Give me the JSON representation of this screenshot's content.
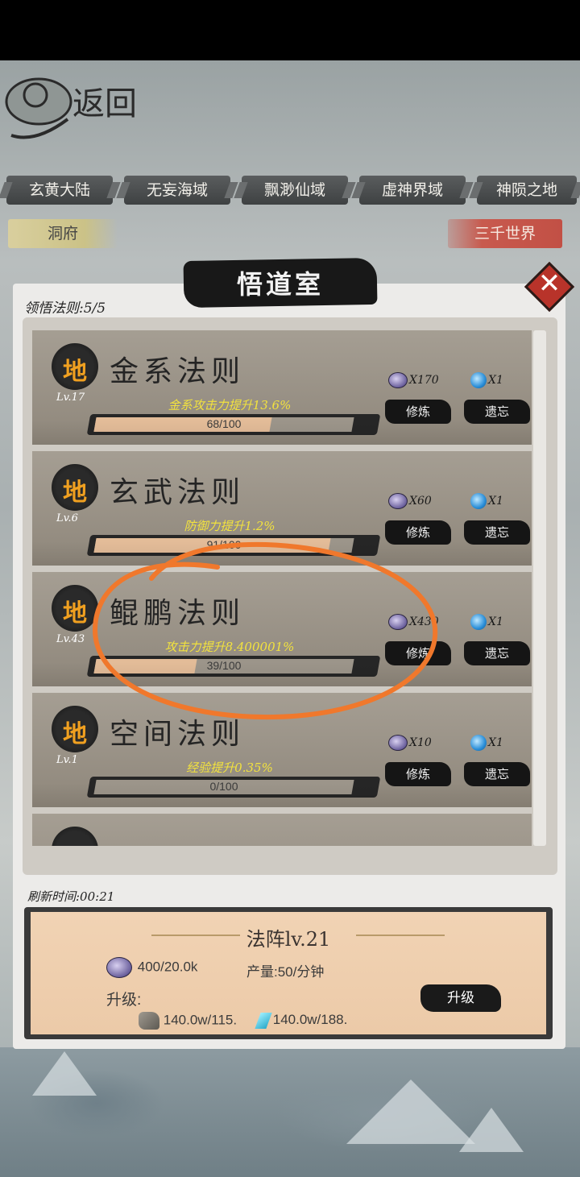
{
  "header": {
    "logo_text": "返回"
  },
  "region_tabs": [
    "玄黄大陆",
    "无妄海域",
    "飘渺仙域",
    "虚神界域",
    "神陨之地"
  ],
  "sub_tabs": {
    "left": "洞府",
    "right": "三千世界"
  },
  "panel": {
    "title": "悟道室",
    "close_label": "✕",
    "count_label": "领悟法则:5/5",
    "refresh_label": "刷新时间:00:21"
  },
  "laws": [
    {
      "badge": "地",
      "level": "Lv.17",
      "name": "金系法则",
      "effect": "金系攻击力提升13.6%",
      "progress_text": "68/100",
      "progress": 0.68,
      "stone_cost": "X170",
      "orb_cost": "X1",
      "train_label": "修炼",
      "forget_label": "遗忘"
    },
    {
      "badge": "地",
      "level": "Lv.6",
      "name": "玄武法则",
      "effect": "防御力提升1.2%",
      "progress_text": "91/100",
      "progress": 0.91,
      "stone_cost": "X60",
      "orb_cost": "X1",
      "train_label": "修炼",
      "forget_label": "遗忘"
    },
    {
      "badge": "地",
      "level": "Lv.43",
      "name": "鲲鹏法则",
      "effect": "攻击力提升8.400001%",
      "progress_text": "39/100",
      "progress": 0.39,
      "stone_cost": "X430",
      "orb_cost": "X1",
      "train_label": "修炼",
      "forget_label": "遗忘"
    },
    {
      "badge": "地",
      "level": "Lv.1",
      "name": "空间法则",
      "effect": "经验提升0.35%",
      "progress_text": "0/100",
      "progress": 0.0,
      "stone_cost": "X10",
      "orb_cost": "X1",
      "train_label": "修炼",
      "forget_label": "遗忘"
    }
  ],
  "formation": {
    "title": "法阵lv.21",
    "stone_amount": "400/20.0k",
    "production": "产量:50/分钟",
    "upgrade_label": "升级:",
    "rock_cost": "140.0w/115.",
    "crystal_cost": "140.0w/188.",
    "upgrade_button": "升级"
  },
  "colors": {
    "accent_red": "#c85a4e",
    "effect_yellow": "#f2e23e",
    "annotation_orange": "#f0782c"
  }
}
